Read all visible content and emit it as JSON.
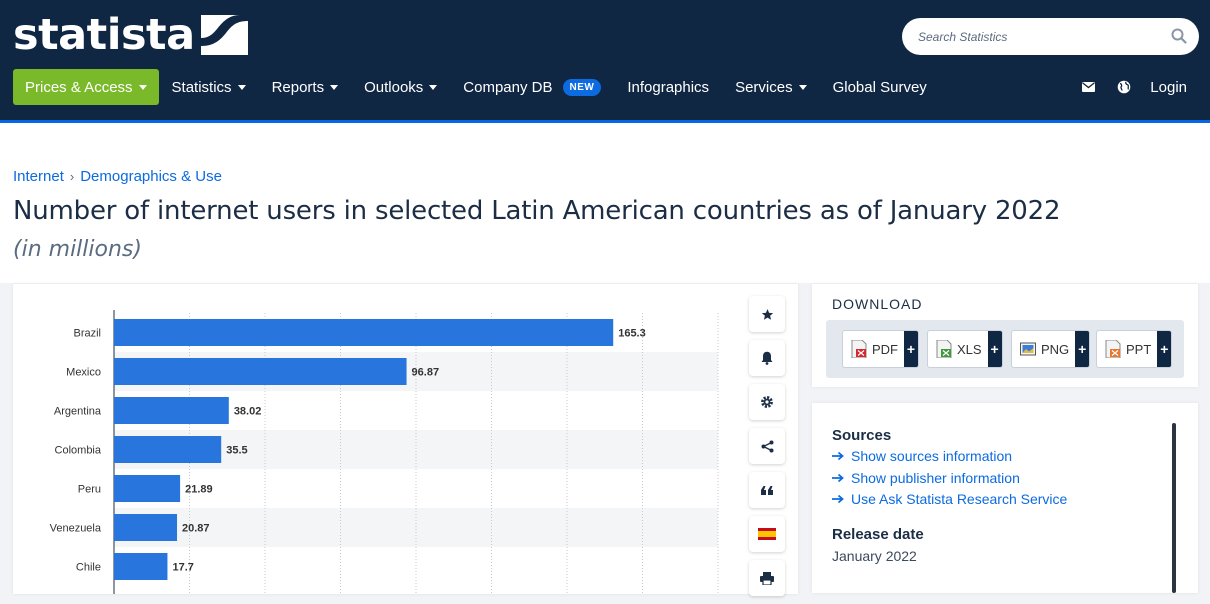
{
  "header": {
    "logo_text": "statista",
    "search_placeholder": "Search Statistics",
    "nav": [
      {
        "label": "Prices & Access",
        "caret": true
      },
      {
        "label": "Statistics",
        "caret": true
      },
      {
        "label": "Reports",
        "caret": true
      },
      {
        "label": "Outlooks",
        "caret": true
      },
      {
        "label": "Company DB",
        "badge": "NEW"
      },
      {
        "label": "Infographics"
      },
      {
        "label": "Services",
        "caret": true
      },
      {
        "label": "Global Survey"
      }
    ],
    "login_label": "Login",
    "icons": [
      "mail-icon",
      "globe-icon"
    ]
  },
  "breadcrumb": [
    "Internet",
    "Demographics & Use"
  ],
  "page": {
    "title": "Number of internet users in selected Latin American countries as of January 2022",
    "subtitle": "(in millions)"
  },
  "chart_data": {
    "type": "bar",
    "orientation": "horizontal",
    "categories": [
      "Brazil",
      "Mexico",
      "Argentina",
      "Colombia",
      "Peru",
      "Venezuela",
      "Chile"
    ],
    "values": [
      165.3,
      96.87,
      38.02,
      35.5,
      21.89,
      20.87,
      17.7
    ],
    "value_labels": [
      "165.3",
      "96.87",
      "38.02",
      "35.5",
      "21.89",
      "20.87",
      "17.7"
    ],
    "xlim": [
      0,
      200
    ],
    "grid": true,
    "bar_color": "#2876dd"
  },
  "toolbar": [
    "star-icon",
    "bell-icon",
    "gear-icon",
    "share-icon",
    "quote-icon",
    "flag-es-icon",
    "print-icon"
  ],
  "download": {
    "title": "DOWNLOAD",
    "buttons": [
      {
        "label": "PDF",
        "icon": "pdf-file-icon"
      },
      {
        "label": "XLS",
        "icon": "xls-file-icon"
      },
      {
        "label": "PNG",
        "icon": "png-file-icon"
      },
      {
        "label": "PPT",
        "icon": "ppt-file-icon"
      }
    ],
    "plus": "+"
  },
  "sources": {
    "heading": "Sources",
    "links": [
      "Show sources information",
      "Show publisher information",
      "Use Ask Statista Research Service"
    ],
    "release_heading": "Release date",
    "release_value": "January 2022"
  },
  "colors": {
    "header_bg": "#0f2742",
    "accent_green": "#7ab929",
    "link_blue": "#0c6be0"
  }
}
